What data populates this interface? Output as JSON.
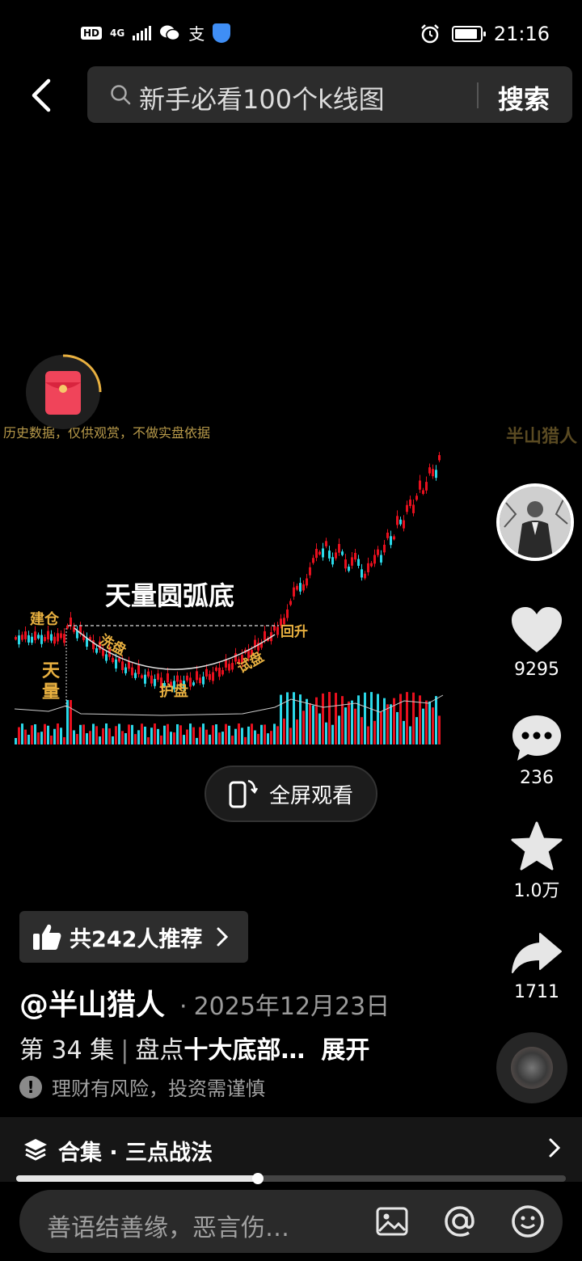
{
  "status_bar": {
    "hd": "HD",
    "network": "4G",
    "pay_glyph": "支",
    "time": "21:16",
    "battery_level": 0.9
  },
  "search": {
    "query": "新手必看100个k线图",
    "button": "搜索"
  },
  "video": {
    "disclaimer": "历史数据，仅供观赏，不做实盘依据",
    "watermark": "半山猎人",
    "title": "天量圆弧底",
    "labels": {
      "jiancang": "建仓",
      "tianliang": "天量",
      "xipan": "洗盘",
      "hupan": "护盘",
      "shipan": "试盘",
      "huisheng": "回升"
    },
    "fullscreen_label": "全屏观看"
  },
  "actions": {
    "likes": "9295",
    "comments": "236",
    "favorites": "1.0万",
    "shares": "1711"
  },
  "info": {
    "recommend": "共242人推荐",
    "author": "@半山猎人",
    "date_sep": "·",
    "date": "2025年12月23日",
    "episode": "第 34 集",
    "episode_sep": "|",
    "summary_prefix": "盘点",
    "summary_bold": "十大底部…",
    "expand": "展开",
    "risk": "理财有风险，投资需谨慎"
  },
  "collection": {
    "label": "合集 · 三点战法",
    "progress": 0.44
  },
  "comment_bar": {
    "placeholder": "善语结善缘，恶言伤…"
  },
  "colors": {
    "up": "#e8101e",
    "down": "#2ad8e8",
    "annotation": "#e8b040"
  }
}
